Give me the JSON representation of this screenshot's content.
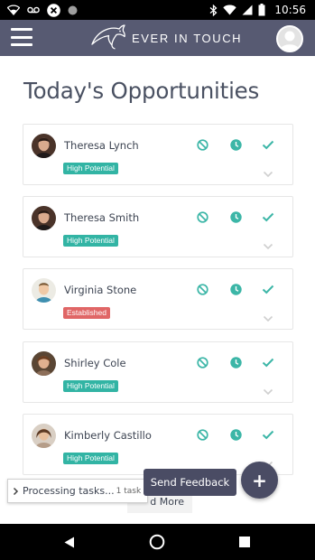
{
  "status_bar": {
    "time": "10:56",
    "icons": [
      "wifi-icon",
      "voicemail-icon",
      "close-circle-icon",
      "dot-icon",
      "bluetooth-icon",
      "wifi-signal-icon",
      "cell-signal-icon",
      "battery-icon"
    ]
  },
  "header": {
    "logo_text": "EVER IN TOUCH",
    "colors": {
      "background": "#575a72"
    }
  },
  "page": {
    "title": "Today's Opportunities"
  },
  "opportunities": [
    {
      "name": "Theresa Lynch",
      "badge": "High Potential",
      "badge_color": "#32b4a4"
    },
    {
      "name": "Theresa Smith",
      "badge": "High Potential",
      "badge_color": "#32b4a4"
    },
    {
      "name": "Virginia Stone",
      "badge": "Established",
      "badge_color": "#e06666"
    },
    {
      "name": "Shirley Cole",
      "badge": "High Potential",
      "badge_color": "#32b4a4"
    },
    {
      "name": "Kimberly Castillo",
      "badge": "High Potential",
      "badge_color": "#32b4a4"
    }
  ],
  "actions": {
    "icons": [
      "block-icon",
      "clock-icon",
      "check-icon",
      "chevron-down-icon"
    ],
    "color": "#3cb6a7"
  },
  "bottom": {
    "load_more": "Load More",
    "load_more_visible": "d More",
    "processing_text": "Processing tasks...",
    "processing_count": "1 task",
    "feedback_label": "Send Feedback",
    "fab_label": "+"
  },
  "nav": {
    "icons": [
      "back-triangle-icon",
      "home-circle-icon",
      "recents-square-icon"
    ]
  }
}
